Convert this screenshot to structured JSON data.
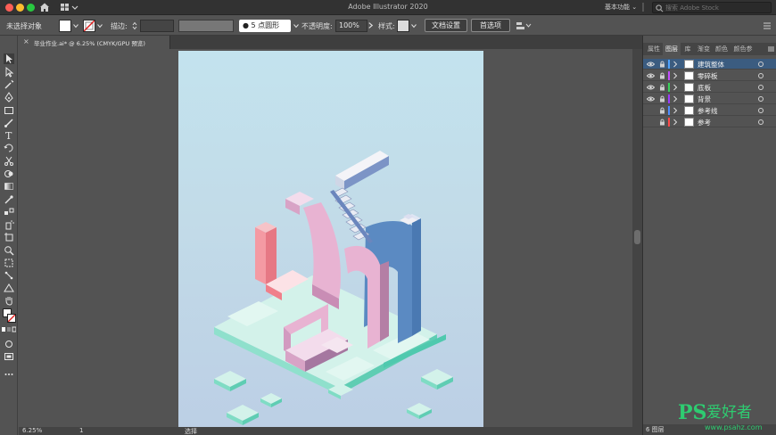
{
  "window": {
    "title": "Adobe Illustrator 2020"
  },
  "titlebar": {
    "workspace": "基本功能",
    "stock_search_placeholder": "搜索 Adobe Stock"
  },
  "controlbar": {
    "selection_status": "未选择对象",
    "stroke_label": "描边:",
    "brush": "5 点圆形",
    "opacity_label": "不透明度:",
    "opacity_value": "100%",
    "style_label": "样式:",
    "doc_setup_button": "文档设置",
    "preferences_button": "首选项"
  },
  "document": {
    "tab_name": "毕业作业.ai* @ 6.25% (CMYK/GPU 预览)"
  },
  "statusbar": {
    "zoom": "6.25%",
    "page": "1",
    "current_tool": "选择"
  },
  "panel": {
    "tabs": [
      "属性",
      "图层",
      "库",
      "渐变",
      "颜色",
      "颜色参"
    ],
    "active_tab": "图层",
    "layers": [
      {
        "name": "建筑整体",
        "color": "#4fa3ff",
        "visible": true,
        "selected": true
      },
      {
        "name": "零碎板",
        "color": "#c24dff",
        "visible": true,
        "selected": false
      },
      {
        "name": "底板",
        "color": "#3ad15a",
        "visible": true,
        "selected": false
      },
      {
        "name": "背景",
        "color": "#9b3cff",
        "visible": true,
        "selected": false
      },
      {
        "name": "参考线",
        "color": "#4f8cff",
        "visible": false,
        "selected": false
      },
      {
        "name": "参考",
        "color": "#ff4a4a",
        "visible": false,
        "selected": false
      }
    ],
    "layer_count": "6 图层"
  },
  "watermark": {
    "brand": "PS",
    "tagline": "爱好者",
    "url": "www.psahz.com"
  },
  "colors": {
    "artboard_top": "#c3e3ee",
    "artboard_bottom": "#bccfe5",
    "pink": "#e8b3d2",
    "blue": "#5b8ac2",
    "teal": "#7fdcc4",
    "coral": "#f07f8a"
  }
}
